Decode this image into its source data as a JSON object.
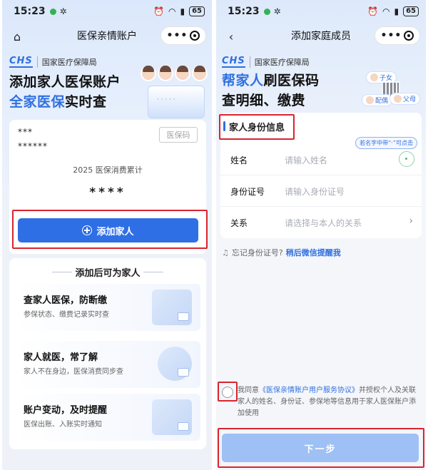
{
  "status": {
    "time": "15:23",
    "battery": "65"
  },
  "left": {
    "nav_title": "医保亲情账户",
    "logo": "CHS",
    "org": "国家医疗保障局",
    "hero_line1": "添加家人医保账户",
    "hero_line2_blue": "全家医保",
    "hero_line2_rest": "实时查",
    "masked_name": "***",
    "masked_id": "******",
    "code_button": "医保码",
    "cost_label": "2025 医保消费累计",
    "cost_value": "****",
    "add_button": "添加家人",
    "benefits_title": "添加后可为家人",
    "benefits": [
      {
        "title": "查家人医保，防断缴",
        "desc": "参保状态、缴费记录实时查"
      },
      {
        "title": "家人就医，常了解",
        "desc": "家人不在身边，医保消费同步查"
      },
      {
        "title": "账户变动，及时提醒",
        "desc": "医保出账、入账实时通知"
      }
    ]
  },
  "right": {
    "nav_title": "添加家庭成员",
    "logo": "CHS",
    "org": "国家医疗保障局",
    "hero_line1_blue": "帮家人",
    "hero_line1_rest": "刷医保码",
    "hero_line2": "查明细、缴费",
    "tags": {
      "child": "子女",
      "spouse": "配偶",
      "parent": "父母"
    },
    "form_title": "家人身份信息",
    "hint": "若名字中带“·”可点击",
    "fields": [
      {
        "label": "姓名",
        "placeholder": "请输入姓名"
      },
      {
        "label": "身份证号",
        "placeholder": "请输入身份证号"
      },
      {
        "label": "关系",
        "placeholder": "请选择与本人的关系"
      }
    ],
    "forgot_text": "忘记身份证号?",
    "forgot_link": "稍后微信提醒我",
    "agree_prefix": "我同意",
    "agree_link": "《医保亲情账户用户服务协议》",
    "agree_suffix": "并授权个人及关联家人的姓名、身份证、参保地等信息用于家人医保账户添加使用",
    "next_button": "下一步"
  },
  "colors": {
    "accent": "#2f6fe6",
    "highlight_border": "#d9242e",
    "disabled_button": "#9ec0f5"
  }
}
